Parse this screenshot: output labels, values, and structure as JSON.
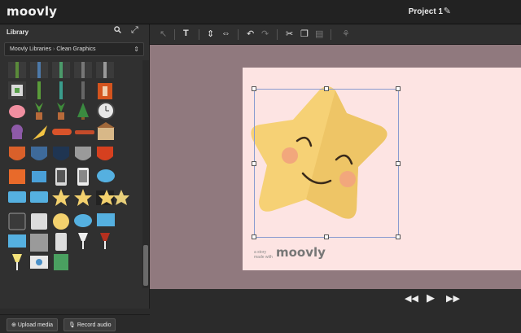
{
  "app": {
    "logo": "moovly"
  },
  "header": {
    "project_title": "Project 1"
  },
  "library": {
    "title": "Library",
    "breadcrumb": [
      "Moovly Libraries",
      "Clean Graphics"
    ]
  },
  "footer": {
    "upload_label": "Upload media",
    "record_label": "Record audio"
  },
  "canvas": {
    "watermark_small": "a story made with",
    "watermark_brand": "moovly"
  },
  "colors": {
    "canvas_bg": "#fde4e3",
    "stage_bg": "#90797e",
    "star_light": "#f6d175",
    "star_dark": "#eec566",
    "cheek": "#f2a77c",
    "selection": "#8a9bd0"
  }
}
